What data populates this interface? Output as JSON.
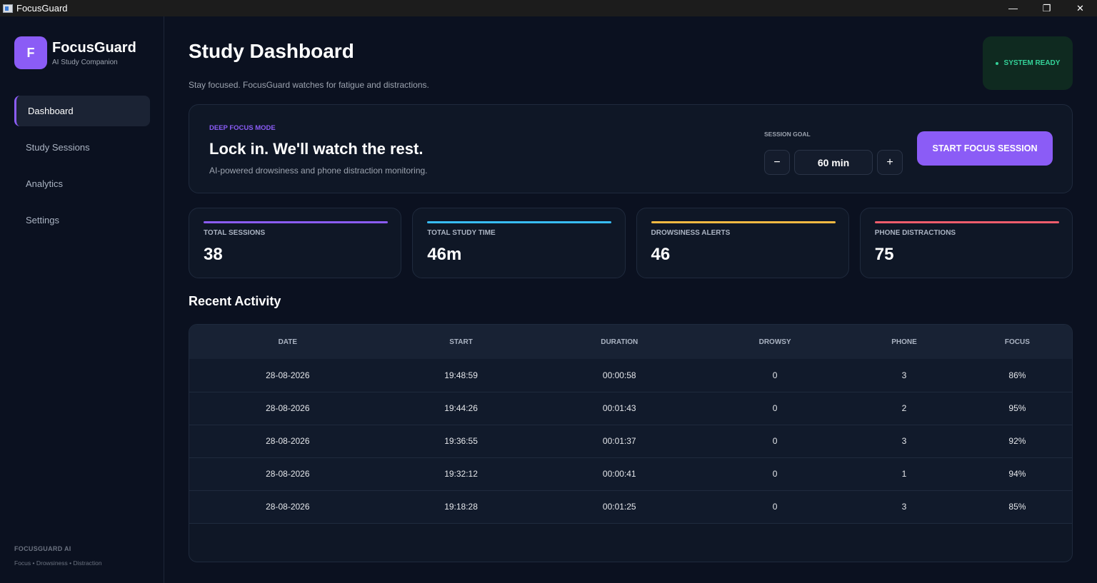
{
  "window": {
    "title": "FocusGuard",
    "controls": {
      "minimize": "—",
      "restore": "❐",
      "close": "✕"
    }
  },
  "sidebar": {
    "logo_letter": "F",
    "brand_name": "FocusGuard",
    "brand_sub": "AI Study Companion",
    "items": [
      {
        "label": "Dashboard",
        "active": true
      },
      {
        "label": "Study Sessions",
        "active": false
      },
      {
        "label": "Analytics",
        "active": false
      },
      {
        "label": "Settings",
        "active": false
      }
    ],
    "footer_title": "FOCUSGUARD AI",
    "footer_sub": "Focus • Drowsiness • Distraction"
  },
  "header": {
    "title": "Study Dashboard",
    "subtitle": "Stay focused. FocusGuard watches for fatigue and distractions.",
    "status": "SYSTEM READY"
  },
  "hero": {
    "kicker": "DEEP FOCUS MODE",
    "title": "Lock in. We'll watch the rest.",
    "description": "AI-powered drowsiness and phone distraction monitoring.",
    "goal_label": "SESSION GOAL",
    "minus_label": "−",
    "plus_label": "+",
    "goal_value": "60 min",
    "start_label": "START FOCUS SESSION"
  },
  "stats": [
    {
      "label": "TOTAL SESSIONS",
      "value": "38",
      "color": "#8b5cf6"
    },
    {
      "label": "TOTAL STUDY TIME",
      "value": "46m",
      "color": "#38bdf8"
    },
    {
      "label": "DROWSINESS ALERTS",
      "value": "46",
      "color": "#f5b942"
    },
    {
      "label": "PHONE DISTRACTIONS",
      "value": "75",
      "color": "#f05d6c"
    }
  ],
  "recent": {
    "title": "Recent Activity",
    "columns": [
      "DATE",
      "START",
      "DURATION",
      "DROWSY",
      "PHONE",
      "FOCUS"
    ],
    "rows": [
      [
        "28-08-2026",
        "19:48:59",
        "00:00:58",
        "0",
        "3",
        "86%"
      ],
      [
        "28-08-2026",
        "19:44:26",
        "00:01:43",
        "0",
        "2",
        "95%"
      ],
      [
        "28-08-2026",
        "19:36:55",
        "00:01:37",
        "0",
        "3",
        "92%"
      ],
      [
        "28-08-2026",
        "19:32:12",
        "00:00:41",
        "0",
        "1",
        "94%"
      ],
      [
        "28-08-2026",
        "19:18:28",
        "00:01:25",
        "0",
        "3",
        "85%"
      ]
    ]
  },
  "colors": {
    "accent": "#8b5cf6",
    "status_green": "#34d399",
    "background": "#0b1120"
  }
}
